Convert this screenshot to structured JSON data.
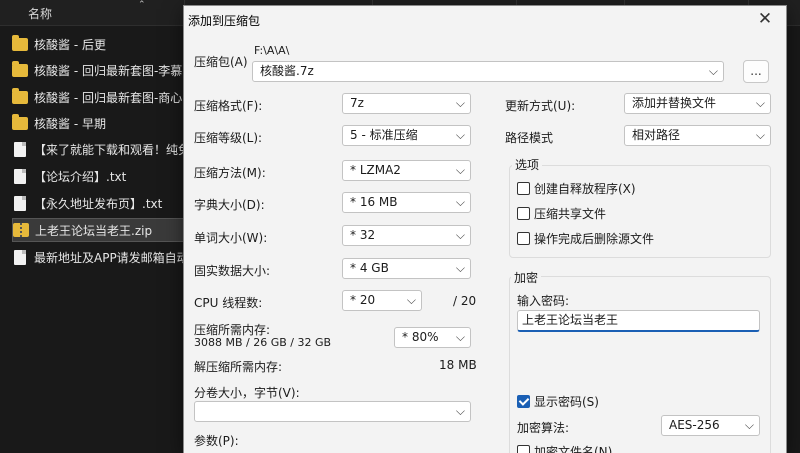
{
  "explorer": {
    "column_name": "名称",
    "items": [
      {
        "type": "folder",
        "label": "核酸酱 - 后更"
      },
      {
        "type": "folder",
        "label": "核酸酱 - 回归最新套图-李慕"
      },
      {
        "type": "folder",
        "label": "核酸酱 - 回归最新套图-商心"
      },
      {
        "type": "folder",
        "label": "核酸酱 - 早期"
      },
      {
        "type": "file",
        "label": "【来了就能下载和观看！纯免"
      },
      {
        "type": "file",
        "label": "【论坛介绍】.txt"
      },
      {
        "type": "file",
        "label": "【永久地址发布页】.txt"
      },
      {
        "type": "zip",
        "label": "上老王论坛当老王.zip"
      },
      {
        "type": "file",
        "label": "最新地址及APP请发邮箱自动"
      }
    ]
  },
  "dialog": {
    "title": "添加到压缩包",
    "close_glyph": "✕",
    "archive": {
      "label": "压缩包(A)",
      "path": "F:\\A\\A\\",
      "name": "核酸酱.7z",
      "browse_label": "..."
    },
    "left": {
      "format": {
        "label": "压缩格式(F):",
        "value": "7z"
      },
      "level": {
        "label": "压缩等级(L):",
        "value": "5 - 标准压缩"
      },
      "method": {
        "label": "压缩方法(M):",
        "value": "*  LZMA2"
      },
      "dict": {
        "label": "字典大小(D):",
        "value": "*  16 MB"
      },
      "word": {
        "label": "单词大小(W):",
        "value": "*  32"
      },
      "solid": {
        "label": "固实数据大小:",
        "value": "*  4 GB"
      },
      "cpu": {
        "label": "CPU 线程数:",
        "value": "*  20",
        "total": "/ 20"
      },
      "mem": {
        "label": "压缩所需内存:",
        "detail": "3088 MB / 26 GB / 32 GB",
        "value": "* 80%"
      },
      "decomp": {
        "label": "解压缩所需内存:",
        "value": "18 MB"
      },
      "split": {
        "label": "分卷大小，字节(V):",
        "value": ""
      },
      "params": {
        "label": "参数(P):"
      }
    },
    "right": {
      "update": {
        "label": "更新方式(U):",
        "value": "添加并替换文件"
      },
      "pathmode": {
        "label": "路径模式",
        "value": "相对路径"
      },
      "options": {
        "title": "选项",
        "sfx": "创建自释放程序(X)",
        "shared": "压缩共享文件",
        "delete": "操作完成后删除源文件"
      },
      "encryption": {
        "title": "加密",
        "pwd_label": "输入密码:",
        "pwd_value": "上老王论坛当老王",
        "show_pwd": "显示密码(S)",
        "method_label": "加密算法:",
        "method_value": "AES-256",
        "encrypt_names": "加密文件名(N)"
      }
    },
    "chevron_glyph": "⌵"
  }
}
